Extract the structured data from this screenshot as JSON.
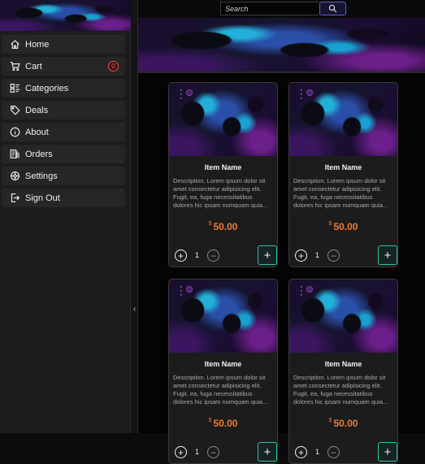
{
  "sidebar": {
    "items": [
      {
        "label": "Home",
        "icon": "home-icon"
      },
      {
        "label": "Cart",
        "icon": "cart-icon",
        "badge": "0"
      },
      {
        "label": "Categories",
        "icon": "categories-icon"
      },
      {
        "label": "Deals",
        "icon": "tag-icon"
      },
      {
        "label": "About",
        "icon": "info-icon"
      },
      {
        "label": "Orders",
        "icon": "orders-icon"
      },
      {
        "label": "Settings",
        "icon": "gear-icon"
      },
      {
        "label": "Sign Out",
        "icon": "sign-out-icon"
      }
    ],
    "collapse_glyph": "‹"
  },
  "search": {
    "placeholder": "Search",
    "value": ""
  },
  "products": [
    {
      "name": "Item Name",
      "description": "Description. Lorem ipsum dolor sit amet consectetur adipisicing elit. Fugit, ea, fuga necessitatibus dolores hic ipsam numquam quia...",
      "currency": "$",
      "price": "50.00",
      "quantity": "1"
    },
    {
      "name": "Item Name",
      "description": "Description. Lorem ipsum dolor sit amet consectetur adipisicing elit. Fugit, ea, fuga necessitatibus dolores hic ipsam numquam quia...",
      "currency": "$",
      "price": "50.00",
      "quantity": "1"
    },
    {
      "name": "Item Name",
      "description": "Description. Lorem ipsum dolor sit amet consectetur adipisicing elit. Fugit, ea, fuga necessitatibus dolores hic ipsam numquam quia...",
      "currency": "$",
      "price": "50.00",
      "quantity": "1"
    },
    {
      "name": "Item Name",
      "description": "Description. Lorem ipsum dolor sit amet consectetur adipisicing elit. Fugit, ea, fuga necessitatibus dolores hic ipsam numquam quia...",
      "currency": "$",
      "price": "50.00",
      "quantity": "1"
    }
  ],
  "colors": {
    "accent_price": "#f07a30",
    "add_button_border": "#30c0a8",
    "search_button_border": "#6060d0",
    "badge": "#e05050"
  }
}
